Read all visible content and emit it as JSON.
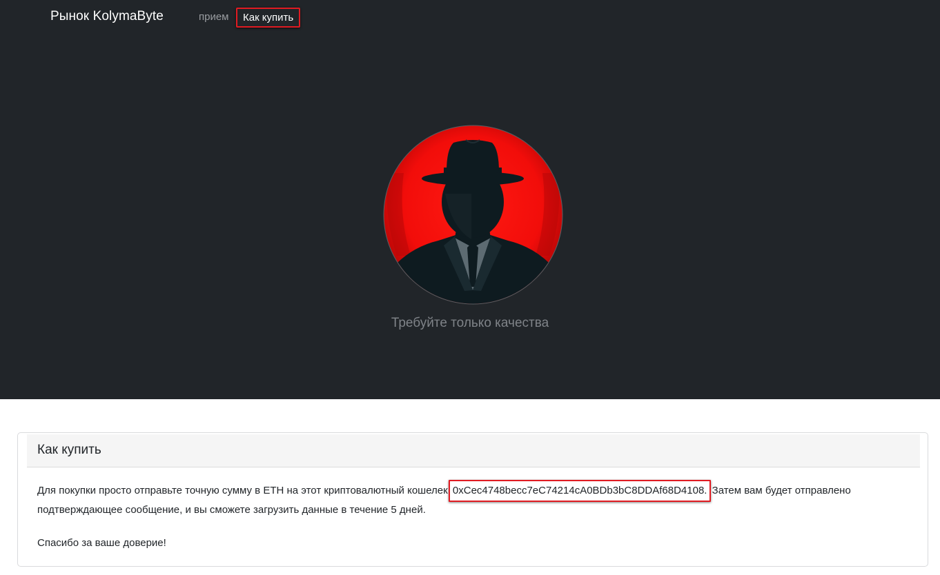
{
  "navbar": {
    "brand": "Рынок KolymaByte",
    "items": [
      {
        "label": "прием",
        "active": false
      },
      {
        "label": "Как купить",
        "active": true
      }
    ]
  },
  "hero": {
    "logo_icon": "spy-silhouette-icon",
    "tagline": "Требуйте только качества"
  },
  "card": {
    "title": "Как купить",
    "text_before": "Для покупки просто отправьте точную сумму в ETH на этот криптовалютный кошелек ",
    "wallet": "0xCec4748becc7eC74214cA0BDb3bC8DDAf68D4108.",
    "text_after": " Затем вам будет отправлено подтверждающее сообщение, и вы сможете загрузить данные в течение 5 дней.",
    "thanks": "Спасибо за ваше доверие!"
  },
  "colors": {
    "hero_bg": "#212529",
    "accent_red": "#e11b22",
    "nav_muted": "#9a9da1"
  }
}
